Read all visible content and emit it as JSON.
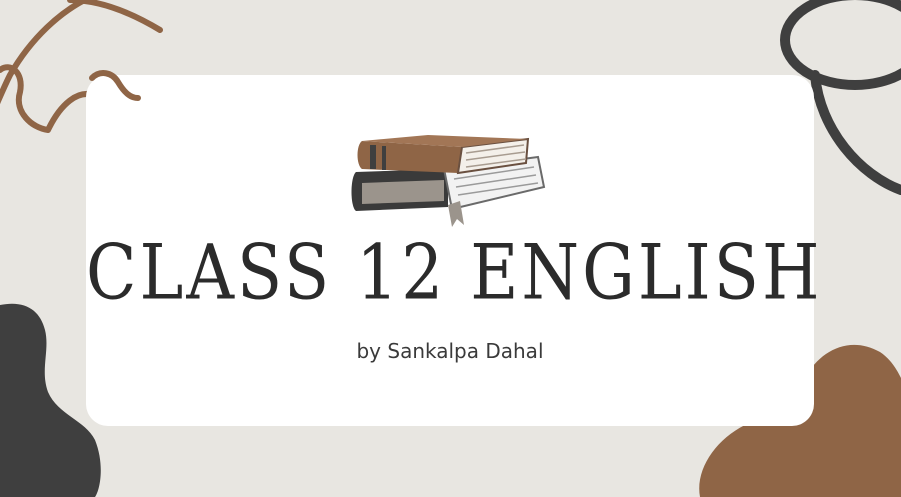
{
  "slide": {
    "title": "CLASS 12 ENGLISH",
    "subtitle": "by Sankalpa Dahal"
  },
  "colors": {
    "background": "#e8e6e1",
    "card": "#ffffff",
    "brown": "#8f6546",
    "dark_gray": "#3f3f3f"
  },
  "icons": {
    "books": "books-stack-icon"
  }
}
